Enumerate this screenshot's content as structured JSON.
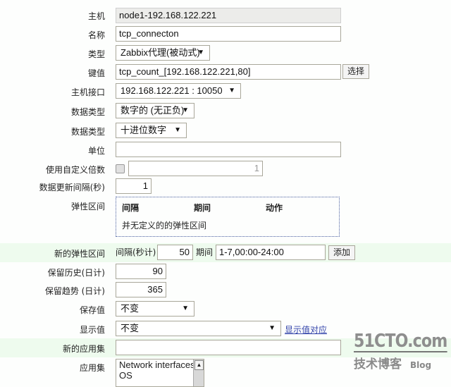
{
  "form": {
    "host": {
      "label": "主机",
      "value": "node1-192.168.122.221"
    },
    "name": {
      "label": "名称",
      "value": "tcp_connecton"
    },
    "type": {
      "label": "类型",
      "value": "Zabbix代理(被动式)"
    },
    "key": {
      "label": "键值",
      "value": "tcp_count_[192.168.122.221,80]",
      "button": "选择"
    },
    "host_interface": {
      "label": "主机接口",
      "value": "192.168.122.221 : 10050"
    },
    "value_type": {
      "label": "数据类型",
      "value": "数字的 (无正负)"
    },
    "data_type": {
      "label": "数据类型",
      "value": "十进位数字"
    },
    "units": {
      "label": "单位",
      "value": ""
    },
    "custom_multiplier": {
      "label": "使用自定义倍数",
      "checked": false,
      "value": "1"
    },
    "update_interval": {
      "label": "数据更新间隔(秒)",
      "value": "1"
    },
    "flexible_intervals": {
      "label": "弹性区间",
      "headers": [
        "间隔",
        "期间",
        "动作"
      ],
      "empty_text": "并无定义的的弹性区间"
    },
    "new_flexible_interval": {
      "label": "新的弹性区间",
      "interval_label": "间隔(秒计)",
      "interval_value": "50",
      "period_label": "期间",
      "period_value": "1-7,00:00-24:00",
      "add_button": "添加"
    },
    "history": {
      "label": "保留历史(日计)",
      "value": "90"
    },
    "trends": {
      "label": "保留趋势 (日计)",
      "value": "365"
    },
    "store_value": {
      "label": "保存值",
      "value": "不变"
    },
    "show_value": {
      "label": "显示值",
      "value": "不变",
      "link": "显示值对应"
    },
    "new_application": {
      "label": "新的应用集",
      "value": ""
    },
    "applications": {
      "label": "应用集",
      "options": [
        "Network interfaces",
        "OS"
      ]
    }
  },
  "watermark": {
    "brand": "51CTO.com",
    "sub": "技术博客",
    "blog": "Blog"
  },
  "colors": {
    "highlight_row": "#eefbee",
    "link": "#3344aa"
  }
}
